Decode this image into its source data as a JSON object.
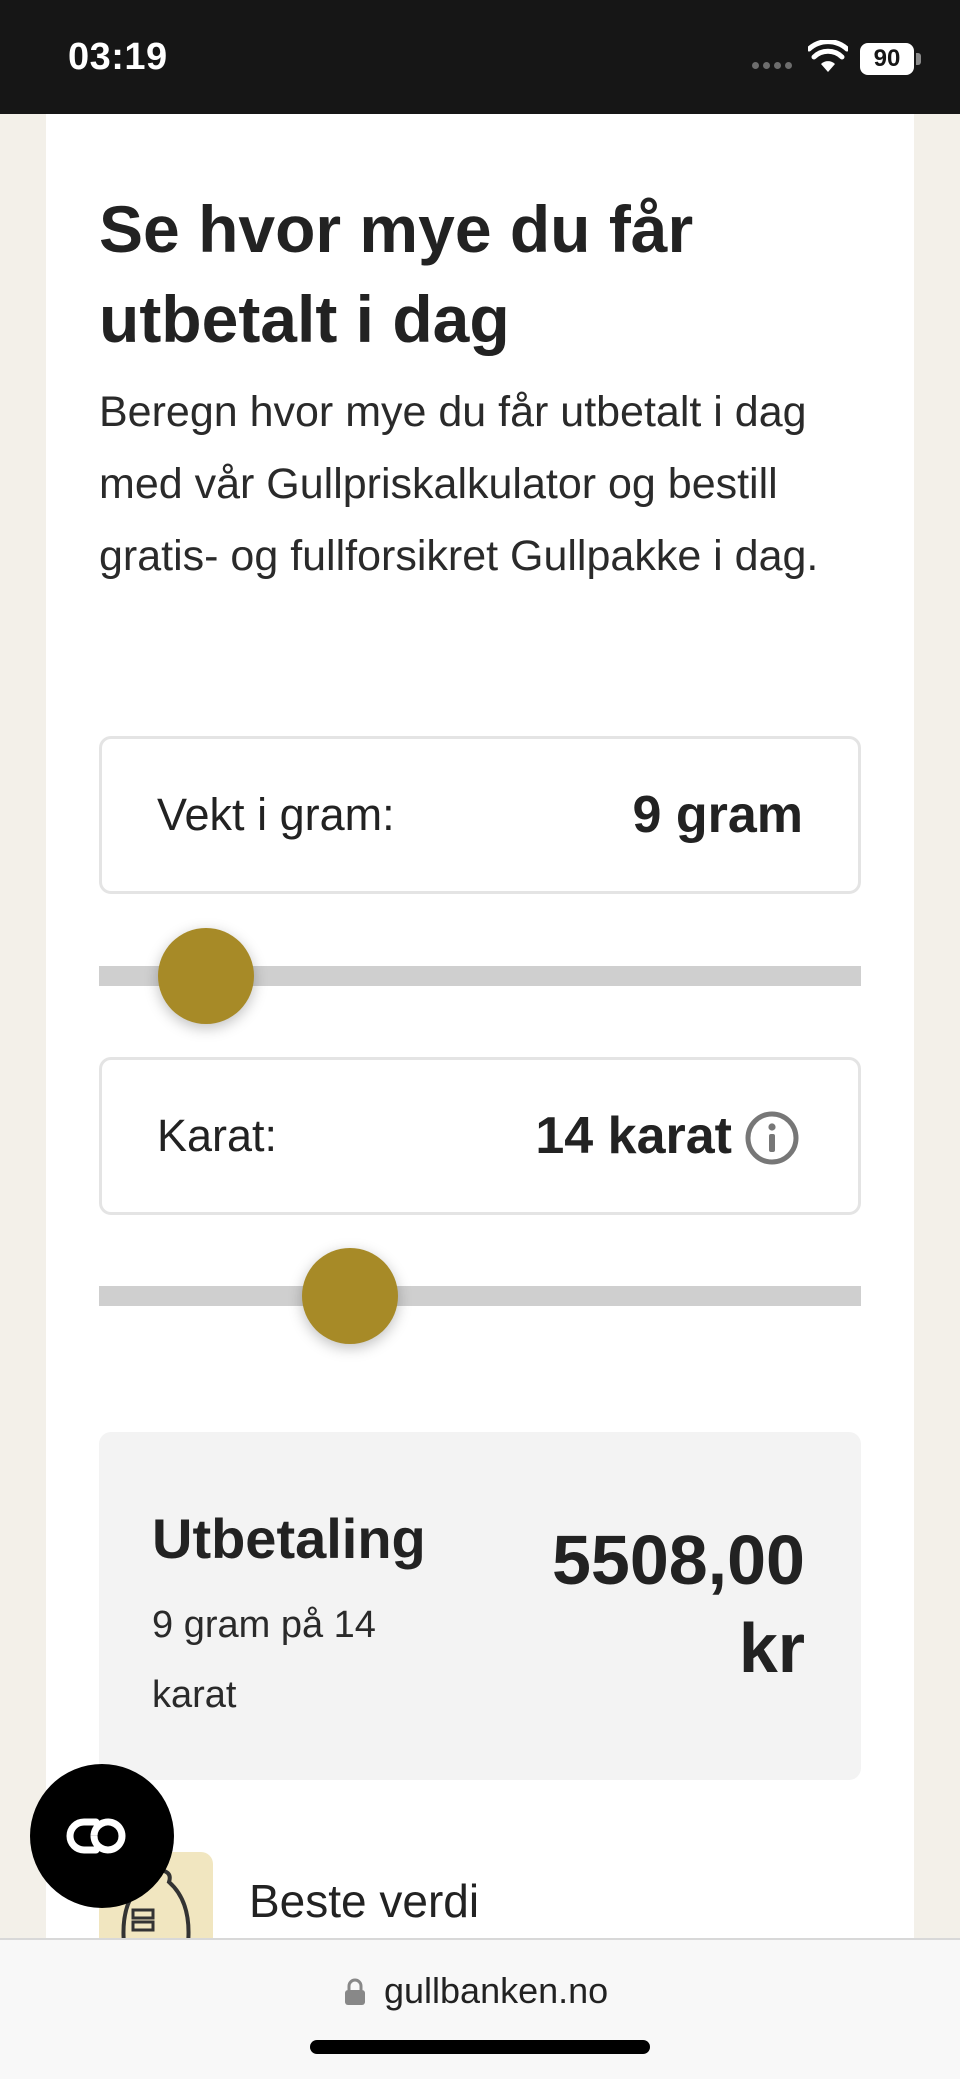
{
  "status_bar": {
    "time": "03:19",
    "battery": "90",
    "icons": [
      "signal-dots-icon",
      "wifi-icon",
      "battery-icon"
    ]
  },
  "calculator": {
    "heading": "Se hvor mye du får utbetalt i dag",
    "lead": "Beregn hvor mye du får utbetalt i dag med vår Gullpriskalkulator og bestill gratis- og fullforsikret Gullpakke i dag.",
    "weight": {
      "label": "Vekt i gram:",
      "value": "9 gram",
      "slider_fraction": 0.14
    },
    "karat": {
      "label": "Karat:",
      "value": "14 karat",
      "info_icon": "info-icon",
      "slider_fraction": 0.33
    },
    "payout": {
      "title": "Utbetaling",
      "subtitle": "9 gram på 14 karat",
      "amount": "5508,00 kr"
    },
    "feature": {
      "label": "Beste verdi",
      "icon": "money-bag-icon"
    }
  },
  "chat_button": {
    "icon": "chat-link-icon"
  },
  "browser": {
    "url": "gullbanken.no",
    "icon": "lock-icon"
  },
  "colors": {
    "accent": "#a78a27",
    "page_background": "#f3f0e9",
    "payout_background": "#f3f3f3",
    "feature_icon_background": "#f1e6c0"
  }
}
